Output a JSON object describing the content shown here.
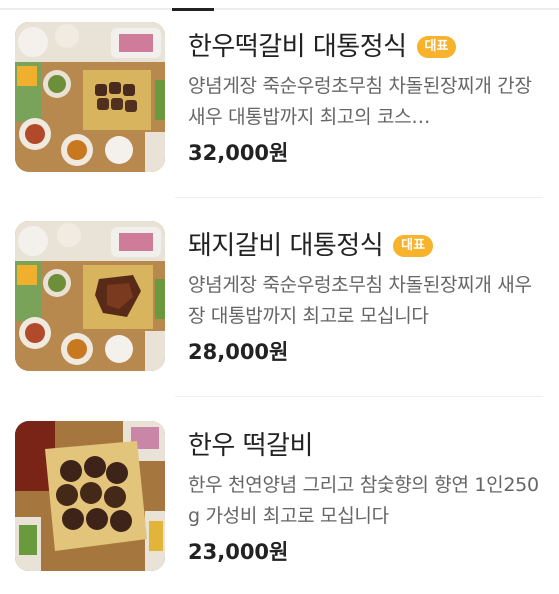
{
  "menu": {
    "items": [
      {
        "name": "한우떡갈비 대통정식",
        "badge": "대표",
        "description": "양념게장 죽순우렁초무침 차돌된장찌개 간장새우 대통밥까지 최고의 코스…",
        "price": "32,000원"
      },
      {
        "name": "돼지갈비 대통정식",
        "badge": "대표",
        "description": "양념게장 죽순우렁초무침 차돌된장찌개 새우장 대통밥까지 최고로 모십니다",
        "price": "28,000원"
      },
      {
        "name": "한우 떡갈비",
        "badge": "",
        "description": "한우 천연양념 그리고 참숯향의 향연 1인250g 가성비 최고로 모십니다",
        "price": "23,000원"
      }
    ]
  },
  "colors": {
    "badge": "#f7b32b",
    "title": "#222222",
    "description": "#666666"
  }
}
